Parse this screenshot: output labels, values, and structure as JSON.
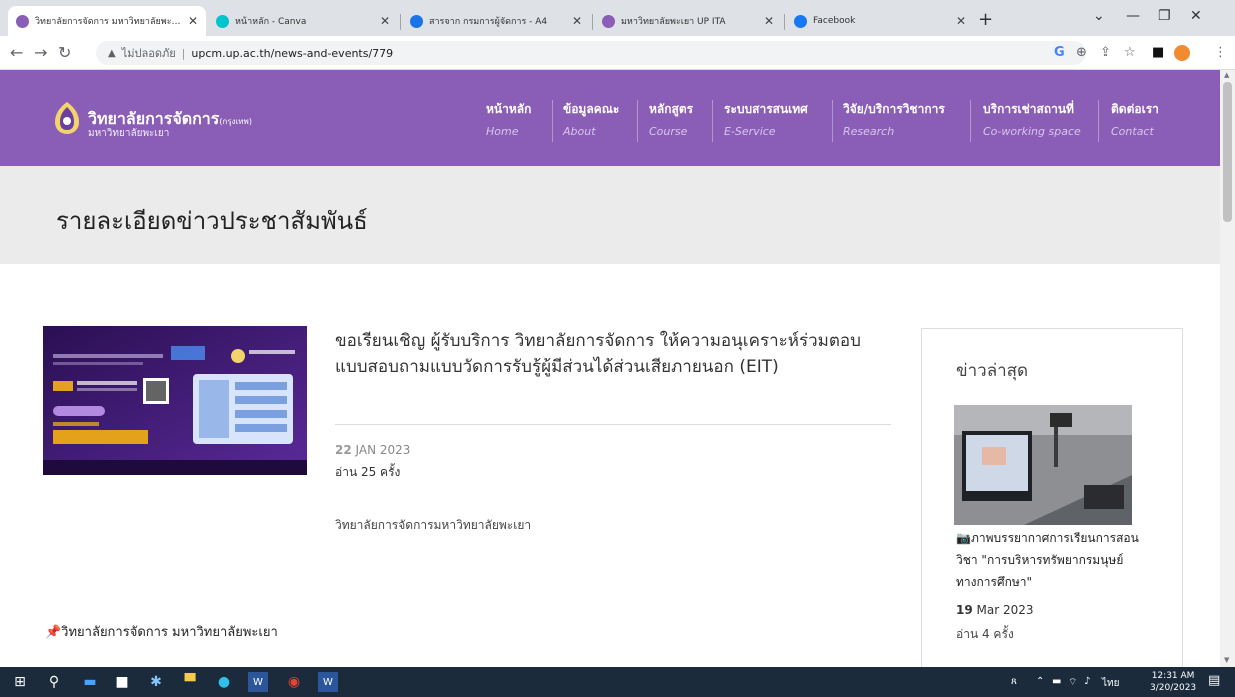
{
  "browser": {
    "tabs": [
      {
        "title": "วิทยาลัยการจัดการ มหาวิทยาลัยพะเยา",
        "favicon_color": "#8a5db7",
        "active": true
      },
      {
        "title": "หน้าหลัก - Canva",
        "favicon_color": "#00c4cc",
        "active": false
      },
      {
        "title": "สารจาก กรมการผู้จัดการ - A4",
        "favicon_color": "#1a73e8",
        "active": false
      },
      {
        "title": "มหาวิทยาลัยพะเยา UP ITA",
        "favicon_color": "#8a5db7",
        "active": false
      },
      {
        "title": "Facebook",
        "favicon_color": "#1877f2",
        "active": false
      }
    ],
    "not_secure_label": "ไม่ปลอดภัย",
    "url": "upcm.up.ac.th/news-and-events/779"
  },
  "site": {
    "logo_title": "วิทยาลัยการจัดการ",
    "logo_title_suffix": "(กรุงเทพ)",
    "logo_subtitle": "มหาวิทยาลัยพะเยา",
    "nav": [
      {
        "th": "หน้าหลัก",
        "en": "Home"
      },
      {
        "th": "ข้อมูลคณะ",
        "en": "About"
      },
      {
        "th": "หลักสูตร",
        "en": "Course"
      },
      {
        "th": "ระบบสารสนเทศ",
        "en": "E-Service"
      },
      {
        "th": "วิจัย/บริการวิชาการ",
        "en": "Research"
      },
      {
        "th": "บริการเช่าสถานที่",
        "en": "Co-working space"
      },
      {
        "th": "ติดต่อเรา",
        "en": "Contact"
      }
    ],
    "colors": {
      "header": "#8a5db7",
      "band": "#ebebeb"
    }
  },
  "page": {
    "title": "รายละเอียดข่าวประชาสัมพันธ์",
    "article": {
      "title": "ขอเรียนเชิญ ผู้รับบริการ วิทยาลัยการจัดการ ให้ความอนุเคราะห์ร่วมตอบแบบสอบถามแบบวัดการรับรู้ผู้มีส่วนได้ส่วนเสียภายนอก (EIT)",
      "date_day": "22",
      "date_rest": "JAN 2023",
      "views": "อ่าน 25 ครั้ง",
      "body": "วิทยาลัยการจัดการมหาวิทยาลัยพะเยา",
      "pin_line": "📌วิทยาลัยการจัดการ มหาวิทยาลัยพะเยา"
    },
    "sidebar": {
      "title": "ข่าวล่าสุด",
      "news": {
        "caption": "📷ภาพบรรยากาศการเรียนการสอนวิชา \"การบริหารทรัพยากรมนุษย์ทางการศึกษา\"",
        "date_day": "19",
        "date_rest": "Mar 2023",
        "views": "อ่าน 4 ครั้ง"
      }
    }
  },
  "taskbar": {
    "lang": "ไทย",
    "time": "12:31 AM",
    "date": "3/20/2023"
  }
}
